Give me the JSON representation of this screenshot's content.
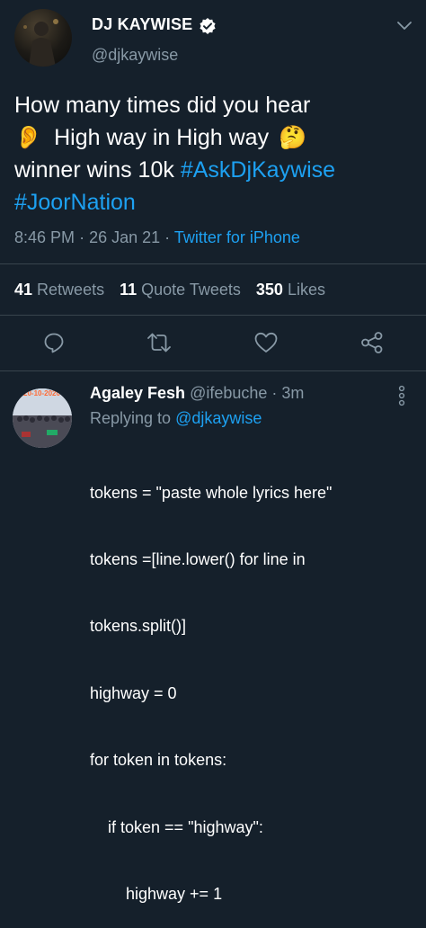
{
  "tweet": {
    "author_name": "DJ KAYWISE",
    "author_handle": "@djkaywise",
    "text_line1": "How many times did you hear",
    "emoji_ear": "👂",
    "text_line2": "High way in High way",
    "emoji_think": "🤔",
    "text_line3": "winner wins 10k",
    "hashtag1": "#AskDjKaywise",
    "hashtag2": "#JoorNation",
    "time": "8:46 PM",
    "date": "26 Jan 21",
    "dot": "·",
    "source": "Twitter for iPhone"
  },
  "stats": {
    "retweets_count": "41",
    "retweets_label": "Retweets",
    "quotes_count": "11",
    "quotes_label": "Quote Tweets",
    "likes_count": "350",
    "likes_label": "Likes"
  },
  "reply": {
    "author_name": "Agaley Fesh",
    "author_handle": "@ifebuche",
    "dot": "·",
    "age": "3m",
    "replying_to_label": "Replying to",
    "replying_to_handle": "@djkaywise",
    "avatar_date": "20-10-2020",
    "code_lines": [
      "tokens = \"paste whole lyrics here\"",
      "tokens =[line.lower() for line in",
      "tokens.split()]",
      "highway = 0",
      "for token in tokens:",
      "    if token == \"highway\":",
      "        highway += 1"
    ]
  },
  "colors": {
    "background": "#15202b",
    "accent": "#1da1f2",
    "muted": "#8899a6",
    "divider": "#38444d"
  },
  "icons": [
    "verified-badge-icon",
    "chevron-down-icon",
    "reply-icon",
    "retweet-icon",
    "like-icon",
    "share-icon",
    "more-vertical-icon"
  ]
}
